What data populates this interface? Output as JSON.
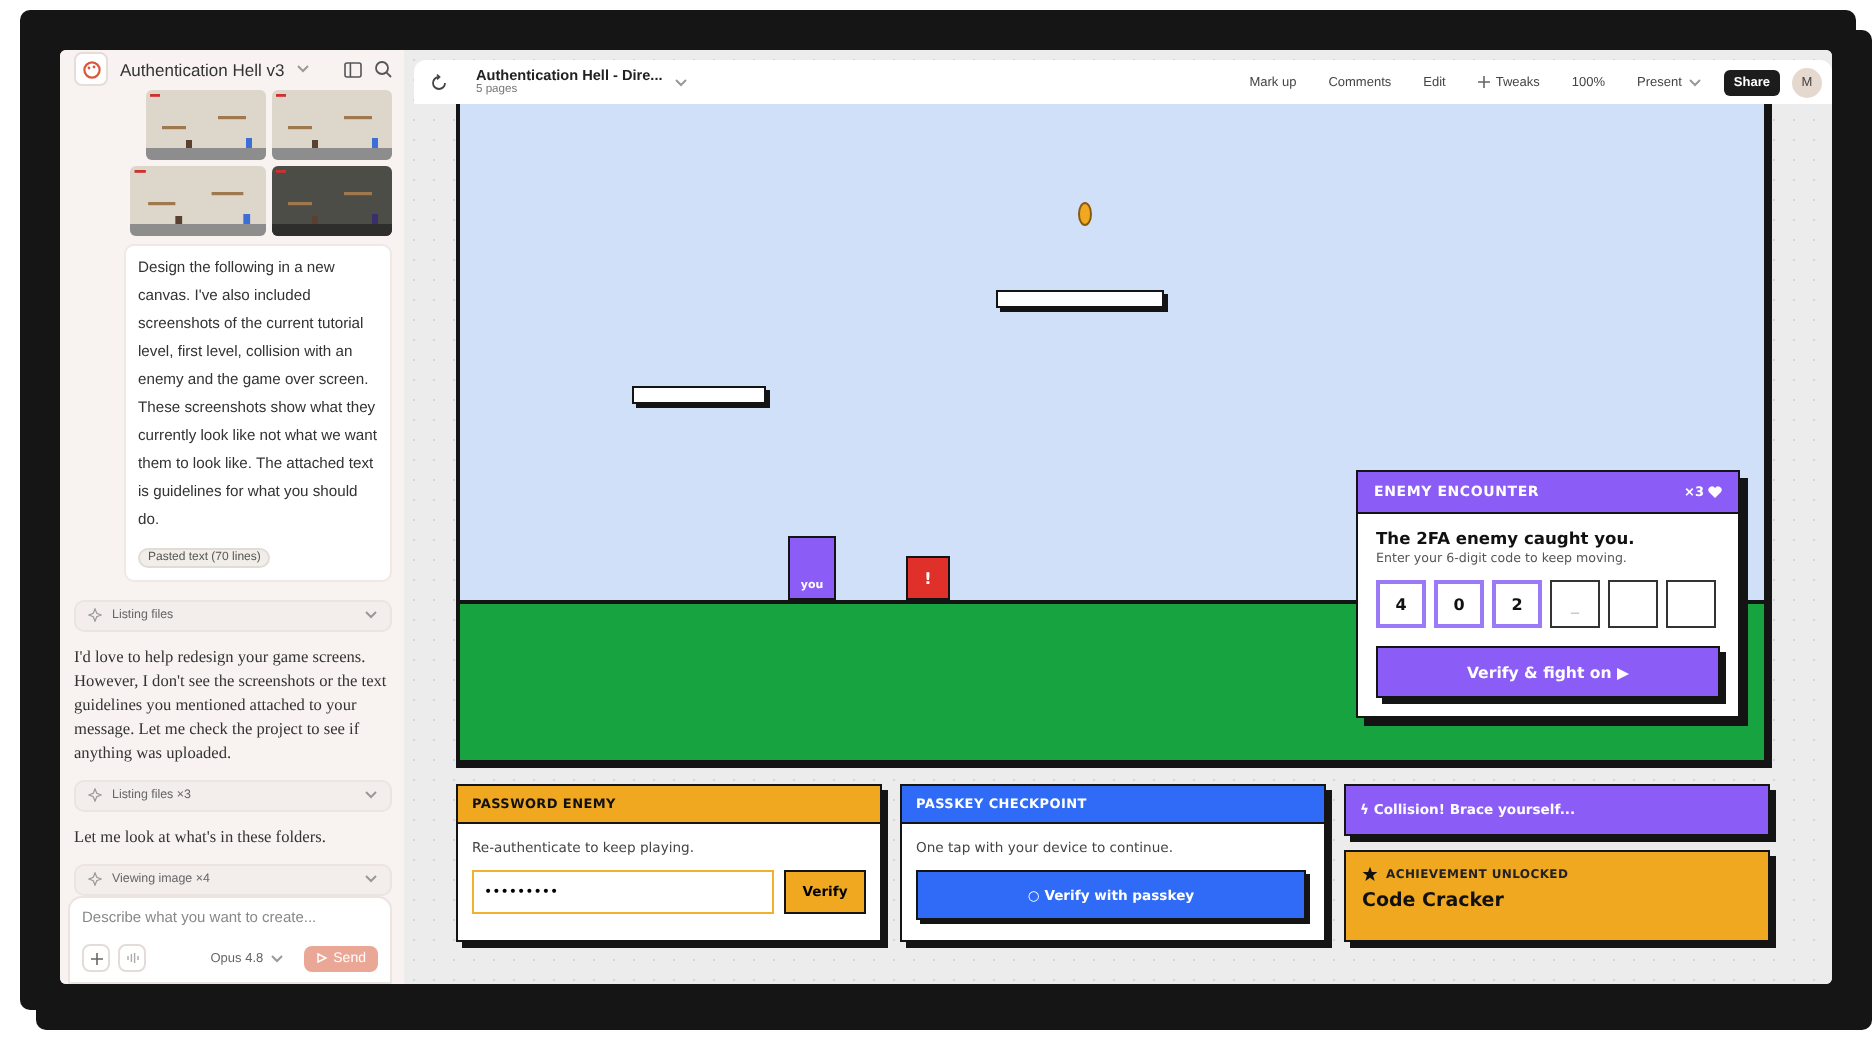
{
  "sidebar": {
    "project_title": "Authentication Hell v3",
    "attachments": [
      {
        "kind": "picture"
      },
      {
        "kind": "picture"
      },
      {
        "kind": "picture"
      },
      {
        "kind": "picture_dark"
      }
    ],
    "user_message": "Design the following in a new canvas. I've also included screenshots of the current tutorial level, first level, collision with an enemy and the game over screen. These screenshots show what they currently look like not what we want them to look like. The attached text is guidelines for what you should do.",
    "attachment_chip": "Pasted text (70 lines)",
    "thread": [
      {
        "kind": "tool",
        "label": "Listing files"
      },
      {
        "kind": "text",
        "text": "I'd love to help redesign your game screens. However, I don't see the screenshots or the text guidelines you mentioned attached to your message. Let me check the project to see if anything was uploaded."
      },
      {
        "kind": "tool",
        "label": "Listing files ×3"
      },
      {
        "kind": "text",
        "text": "Let me look at what's in these folders."
      },
      {
        "kind": "tool",
        "label": "Viewing image ×4"
      }
    ],
    "composer": {
      "placeholder": "Describe what you want to create...",
      "model": "Opus 4.8",
      "send": "Send"
    }
  },
  "toolbar": {
    "title": "Authentication Hell - Dire...",
    "subtitle": "5 pages",
    "actions": [
      {
        "kind": "plain",
        "label": "Mark up"
      },
      {
        "kind": "plain",
        "label": "Comments"
      },
      {
        "kind": "plain",
        "label": "Edit"
      },
      {
        "kind": "plus",
        "label": "Tweaks"
      },
      {
        "kind": "plain",
        "label": "100%"
      },
      {
        "kind": "menu",
        "label": "Present"
      }
    ],
    "share": "Share",
    "avatar": "M"
  },
  "game": {
    "player_label": "you",
    "enemy_label": "!",
    "encounter": {
      "title": "ENEMY ENCOUNTER",
      "lives": "×3",
      "heading": "The 2FA enemy caught you.",
      "subtext": "Enter your 6-digit code to keep moving.",
      "code_boxes": [
        {
          "kind": "filled",
          "digit": "4"
        },
        {
          "kind": "filled",
          "digit": "0"
        },
        {
          "kind": "filled",
          "digit": "2"
        },
        {
          "kind": "cursor",
          "digit": "_"
        },
        {
          "kind": "empty"
        },
        {
          "kind": "empty"
        }
      ],
      "button": "Verify & fight on ▶"
    }
  },
  "cards": {
    "password": {
      "title": "PASSWORD ENEMY",
      "text": "Re-authenticate to keep playing.",
      "value": "•••••••••",
      "button": "Verify"
    },
    "passkey": {
      "title": "PASSKEY CHECKPOINT",
      "text": "One tap with your device to continue.",
      "button": "○ Verify with passkey"
    },
    "banner": "ϟ Collision! Brace yourself...",
    "achievement": {
      "label": "ACHIEVEMENT UNLOCKED",
      "title": "Code Cracker"
    }
  }
}
